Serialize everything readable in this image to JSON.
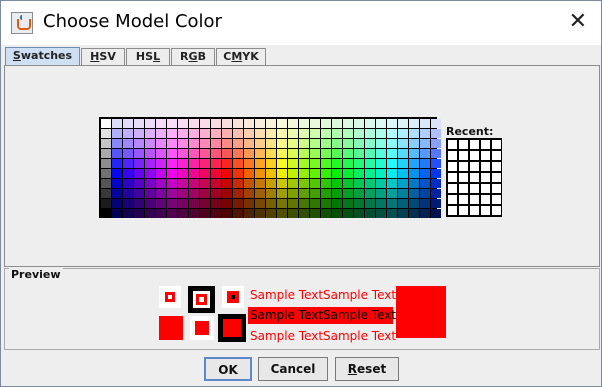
{
  "window": {
    "title": "Choose Model Color",
    "close_glyph": "✕"
  },
  "tabs": [
    {
      "label": "Swatches",
      "mnemonic_index": 0,
      "active": true
    },
    {
      "label": "HSV",
      "mnemonic_index": 0,
      "active": false
    },
    {
      "label": "HSL",
      "mnemonic_index": 2,
      "active": false
    },
    {
      "label": "RGB",
      "mnemonic_index": 1,
      "active": false
    },
    {
      "label": "CMYK",
      "mnemonic_index": 1,
      "active": false
    }
  ],
  "swatches": {
    "rows": 10,
    "cols": 31
  },
  "recent": {
    "label": "Recent:",
    "rows": 7,
    "cols": 5,
    "color": "#ffffff"
  },
  "preview": {
    "label": "Preview",
    "sample_text": "Sample Text",
    "selected_color": "#ff0000",
    "inverse_bg": "#ff0000",
    "inverse_fg": "#000000"
  },
  "buttons": {
    "ok": "OK",
    "cancel": "Cancel",
    "reset": "Reset"
  },
  "icons": {
    "app": "java-cup-icon",
    "close": "close-icon"
  }
}
